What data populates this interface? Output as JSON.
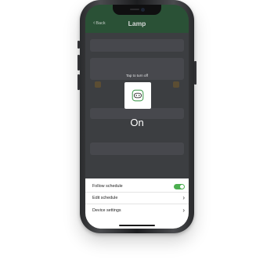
{
  "header": {
    "back_label": "Back",
    "title": "Lamp"
  },
  "control": {
    "hint": "Tap to turn off",
    "state": "On",
    "icon": "smart-plug-icon"
  },
  "sheet": {
    "items": [
      {
        "label": "Follow schedule",
        "control": "toggle",
        "enabled": true
      },
      {
        "label": "Edit schedule",
        "control": "chevron"
      },
      {
        "label": "Device settings",
        "control": "chevron"
      }
    ]
  },
  "colors": {
    "header": "#2e5a3b",
    "toggle_on": "#4caf50",
    "sheet": "#ffffff"
  }
}
